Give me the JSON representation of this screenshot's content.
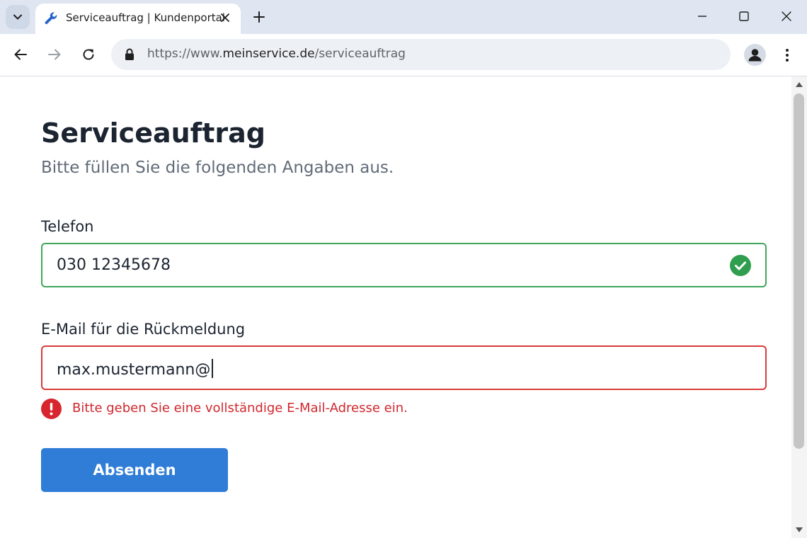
{
  "browser": {
    "tab": {
      "title": "Serviceauftrag | Kundenportal",
      "favicon": "wrench-icon"
    },
    "url": {
      "prefix": "https://www.",
      "host": "meinservice.de",
      "path": "/serviceauftrag"
    },
    "icons": {
      "tab_search": "chevron-down-icon",
      "tab_close": "close-icon",
      "new_tab": "plus-icon",
      "minimize": "minimize-icon",
      "maximize": "maximize-icon",
      "close_window": "close-icon",
      "back": "arrow-left-icon",
      "forward": "arrow-right-icon",
      "reload": "reload-icon",
      "lock": "lock-icon",
      "profile": "profile-icon",
      "menu": "kebab-menu-icon"
    }
  },
  "form": {
    "title": "Serviceauftrag",
    "subtitle": "Bitte füllen Sie die folgenden Angaben aus.",
    "phone": {
      "label": "Telefon",
      "value": "030 12345678",
      "status": "valid",
      "status_icon": "check-circle-icon"
    },
    "email": {
      "label": "E-Mail für die Rückmeldung",
      "value": "max.mustermann@",
      "status": "invalid",
      "error_icon": "alert-circle-icon",
      "error": "Bitte geben Sie eine vollständige E-Mail-Adresse ein."
    },
    "submit_label": "Absenden"
  },
  "colors": {
    "valid": "#3fa75a",
    "invalid": "#d73a3a",
    "error_text": "#d0282e",
    "primary_button": "#2f7dd6"
  }
}
